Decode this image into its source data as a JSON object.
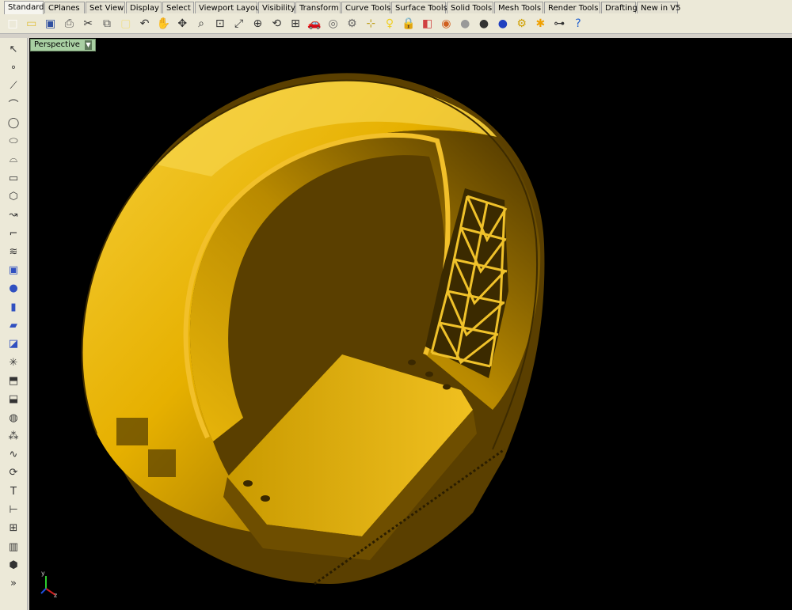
{
  "tabs": [
    {
      "label": "Standard",
      "active": true
    },
    {
      "label": "CPlanes"
    },
    {
      "label": "Set View"
    },
    {
      "label": "Display"
    },
    {
      "label": "Select"
    },
    {
      "label": "Viewport Layout"
    },
    {
      "label": "Visibility"
    },
    {
      "label": "Transform"
    },
    {
      "label": "Curve Tools"
    },
    {
      "label": "Surface Tools"
    },
    {
      "label": "Solid Tools"
    },
    {
      "label": "Mesh Tools"
    },
    {
      "label": "Render Tools"
    },
    {
      "label": "Drafting"
    },
    {
      "label": "New in V5"
    }
  ],
  "toolbar_icons": [
    "new-file-icon",
    "open-file-icon",
    "save-icon",
    "print-icon",
    "cut-icon",
    "copy-icon",
    "paste-icon",
    "undo-icon",
    "pan-hand-icon",
    "move-view-icon",
    "zoom-icon",
    "zoom-window-icon",
    "zoom-extents-icon",
    "zoom-selected-icon",
    "rotate-view-icon",
    "four-viewports-icon",
    "car-render-icon",
    "object-properties-icon",
    "options-icon",
    "snap-icon",
    "light-bulb-icon",
    "lock-icon",
    "layer-icon",
    "color-wheel-icon",
    "sphere-shaded-icon",
    "sphere-rendered-icon",
    "sphere-blue-icon",
    "gear-icon",
    "lightbulb-palette-icon",
    "select-points-icon",
    "help-icon"
  ],
  "left_icons": [
    "select-arrow-icon",
    "point-icon",
    "polyline-icon",
    "curve-control-points-icon",
    "circle-icon",
    "ellipse-icon",
    "arc-icon",
    "rectangle-icon",
    "polygon-icon",
    "curve-from-object-icon",
    "fillet-curves-icon",
    "offset-curve-icon",
    "box-icon",
    "sphere-icon",
    "cylinder-icon",
    "surface-from-curves-icon",
    "blend-surface-icon",
    "explode-icon",
    "trim-icon",
    "split-icon",
    "boolean-union-icon",
    "group-icon",
    "edit-curve-icon",
    "rotate-icon",
    "text-icon",
    "dimension-icon",
    "array-icon",
    "analyze-icon",
    "mesh-box-icon",
    "more-tools-icon"
  ],
  "viewport": {
    "label": "Perspective"
  },
  "axes": {
    "y": "y",
    "z": "z"
  },
  "colors": {
    "ring_gold": "#e1ad00",
    "ring_light": "#f4c621",
    "ring_dark": "#6e4e00",
    "viewport_bg": "#000000",
    "title_green": "#a9d0a3"
  }
}
